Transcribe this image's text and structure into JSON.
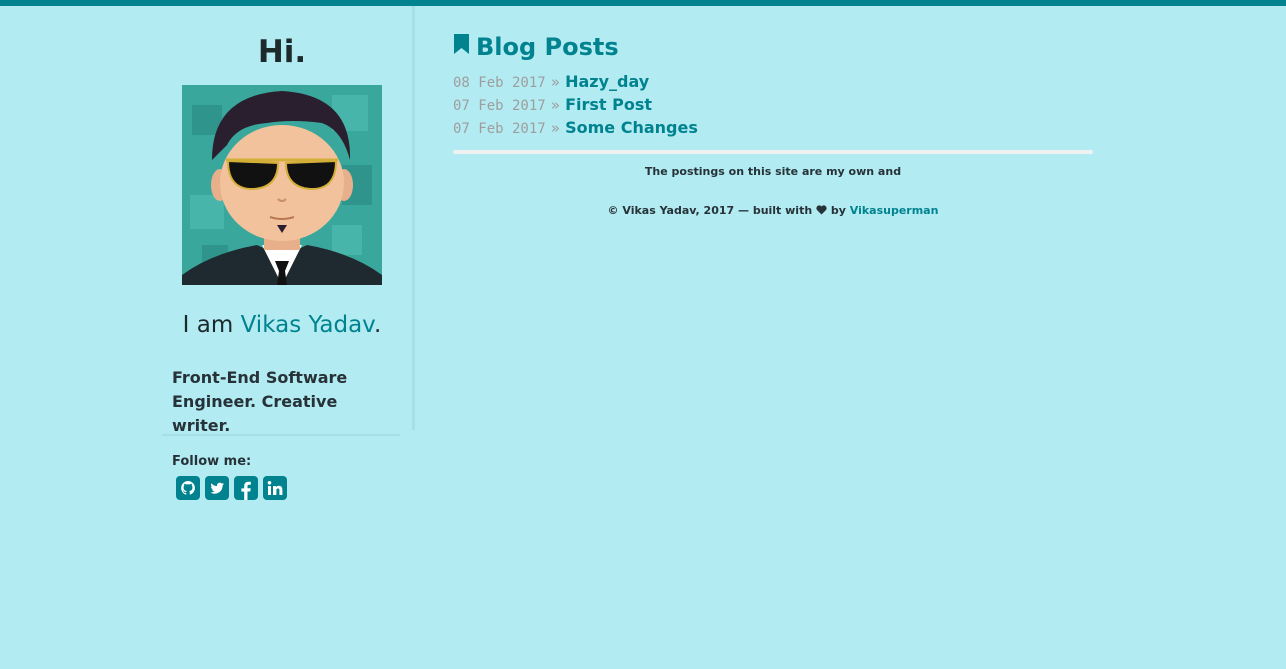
{
  "colors": {
    "background": "#b2ebf2",
    "accent": "#00838f",
    "text": "#263238",
    "muted": "#9e9e9e"
  },
  "sidebar": {
    "greeting": "Hi.",
    "avatar_icon": "cartoon-avatar-sunglasses",
    "intro_prefix": "I am ",
    "name": "Vikas Yadav",
    "intro_suffix": ".",
    "bio": "Front-End Software Engineer. Creative writer.",
    "follow_label": "Follow me:",
    "social": [
      {
        "icon": "github-icon"
      },
      {
        "icon": "twitter-icon"
      },
      {
        "icon": "facebook-icon"
      },
      {
        "icon": "linkedin-icon"
      }
    ]
  },
  "main": {
    "title_icon": "bookmark-icon",
    "title": "Blog Posts",
    "separator": "»",
    "posts": [
      {
        "date": "08 Feb 2017",
        "title": "Hazy_day"
      },
      {
        "date": "07 Feb 2017",
        "title": "First Post"
      },
      {
        "date": "07 Feb 2017",
        "title": "Some Changes"
      }
    ],
    "disclaimer": "The postings on this site are my own and"
  },
  "footer": {
    "text": "© Vikas Yadav, 2017 — built with",
    "heart_icon": "heart-icon",
    "by": "by",
    "author_link": "Vikasuperman"
  }
}
